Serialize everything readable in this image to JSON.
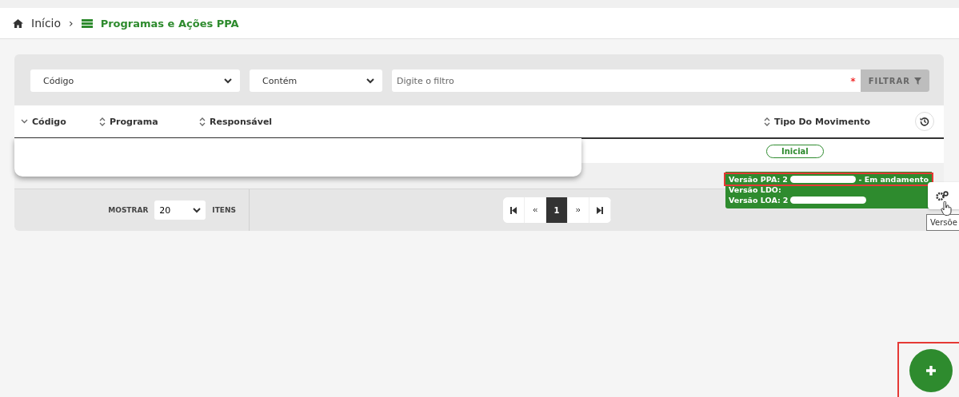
{
  "breadcrumb": {
    "home": "Início",
    "separator": "›",
    "current": "Programas e Ações PPA"
  },
  "filter": {
    "field": "Código",
    "operator": "Contém",
    "placeholder": "Digite o filtro",
    "required_mark": "*",
    "button": "FILTRAR"
  },
  "table": {
    "columns": [
      {
        "label": "Código",
        "kind": "sorted"
      },
      {
        "label": "Programa",
        "kind": "sortable"
      },
      {
        "label": "Responsável",
        "kind": "sortable"
      },
      {
        "label": "Tipo Do Movimento",
        "kind": "sortable"
      }
    ],
    "rows": [
      {
        "tipo": "Inicial"
      }
    ]
  },
  "footer": {
    "show_label": "MOSTRAR",
    "page_size": "20",
    "items_label": "ITENS",
    "pages": [
      {
        "label": "1",
        "selected": true
      }
    ]
  },
  "versions_tooltip": {
    "lines": [
      {
        "label": "Versão PPA:",
        "value": "2",
        "suffix": "- Em andamento",
        "highlighted": true
      },
      {
        "label": "Versão LDO:",
        "highlighted": false
      },
      {
        "label": "Versão LOA:",
        "value": "2",
        "highlighted": false
      }
    ]
  },
  "hover_hint": "Versõe"
}
